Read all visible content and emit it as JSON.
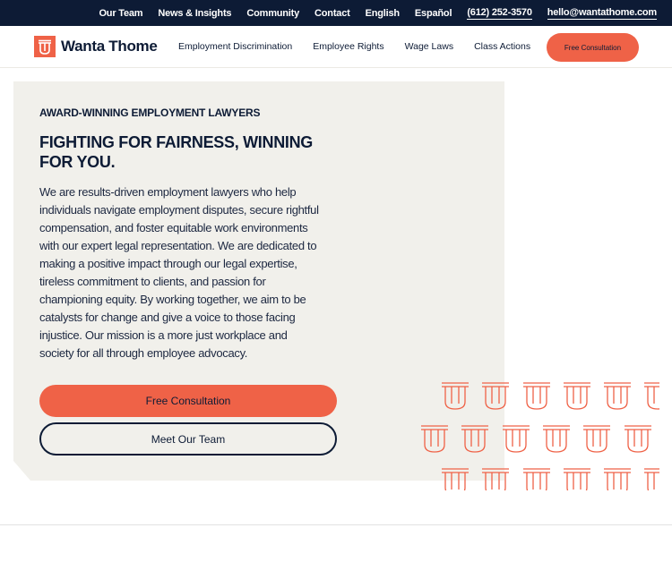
{
  "topbar": {
    "links": [
      "Our Team",
      "News & Insights",
      "Community",
      "Contact",
      "English",
      "Español"
    ],
    "phone": "(612) 252-3570",
    "email": "hello@wantathome.com"
  },
  "brand": {
    "name": "Wanta Thome",
    "accent_color": "#ef6247",
    "navy_color": "#0d1b35",
    "logo_icon": "wt-monogram-icon"
  },
  "nav": {
    "links": [
      "Employment Discrimination",
      "Employee Rights",
      "Wage Laws",
      "Class Actions"
    ],
    "cta": "Free Consultation"
  },
  "hero": {
    "eyebrow": "AWARD-WINNING EMPLOYMENT LAWYERS",
    "headline": "FIGHTING FOR FAIRNESS, WINNING FOR YOU.",
    "body": "We are results-driven employment lawyers who help individuals navigate employment disputes, secure rightful compensation, and foster equitable work environments with our expert legal representation. We are dedicated to making a positive impact through our legal expertise, tireless commitment to clients, and passion for championing equity. By working together, we aim to be catalysts for change and give a voice to those facing injustice. Our mission is a more just workplace and society for all through employee advocacy.",
    "primary_button": "Free Consultation",
    "secondary_button": "Meet Our Team",
    "background_color": "#f1f0eb"
  },
  "decor": {
    "pattern_icon": "wt-monogram-pattern-icon"
  }
}
